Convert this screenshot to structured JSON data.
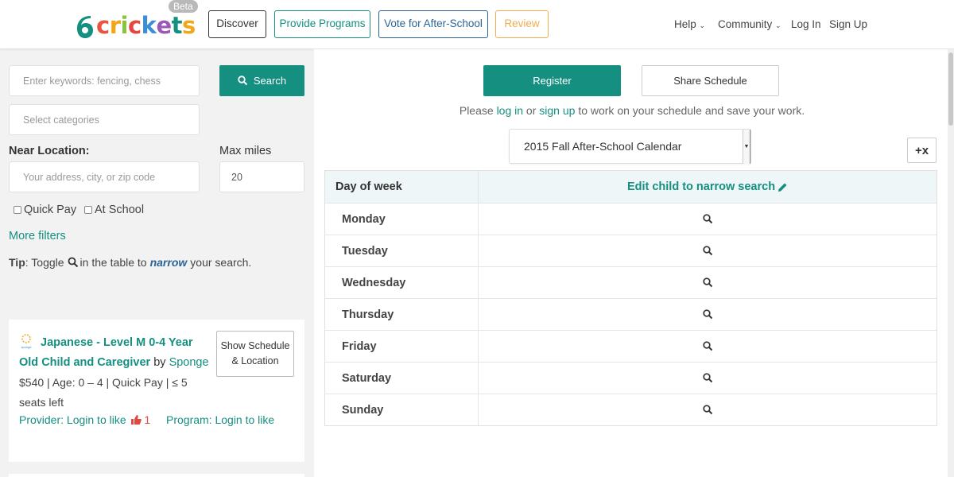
{
  "header": {
    "logo_text": "6crickets",
    "logo_badge": "Beta",
    "nav": {
      "discover": "Discover",
      "provide": "Provide Programs",
      "vote": "Vote for After-School",
      "review": "Review"
    },
    "right": {
      "help": "Help",
      "community": "Community",
      "login": "Log In",
      "signup": "Sign Up"
    },
    "colors": {
      "provide": "#148f80",
      "vote": "#2a6496",
      "review": "#f0ad4e"
    }
  },
  "search": {
    "keywords_placeholder": "Enter keywords: fencing, chess",
    "search_button": "Search",
    "categories_placeholder": "Select categories",
    "near_location_label": "Near Location:",
    "max_miles_label": "Max miles",
    "address_placeholder": "Your address, city, or zip code",
    "max_miles_value": "20",
    "quick_pay": "Quick Pay",
    "at_school": "At School",
    "more_filters": "More filters",
    "tip_label": "Tip",
    "tip_toggle": ": Toggle",
    "tip_mid": "in the table to",
    "tip_narrow": "narrow",
    "tip_end": "your search."
  },
  "program_card": {
    "provider_logo_text": "sponge",
    "title": "Japanese - Level M 0-4 Year Old Child and Caregiver",
    "by": "by",
    "provider": "Sponge",
    "meta": "$540 | Age: 0 – 4 | Quick Pay | ≤ 5 seats left",
    "show_button_line1": "Show Schedule",
    "show_button_line2": "& Location",
    "provider_like": "Provider: Login to like",
    "like_count": "1",
    "program_like": "Program: Login to like"
  },
  "schedule": {
    "register_button": "Register",
    "share_button": "Share Schedule",
    "notice_pre": "Please",
    "notice_login": "log in",
    "notice_or": "or",
    "notice_signup": "sign up",
    "notice_post": "to work on your schedule and save your work.",
    "calendar_selected": "2015 Fall After-School Calendar",
    "table_header_day": "Day of week",
    "table_header_edit": "Edit child to narrow search",
    "days": [
      "Monday",
      "Tuesday",
      "Wednesday",
      "Thursday",
      "Friday",
      "Saturday",
      "Sunday"
    ]
  }
}
